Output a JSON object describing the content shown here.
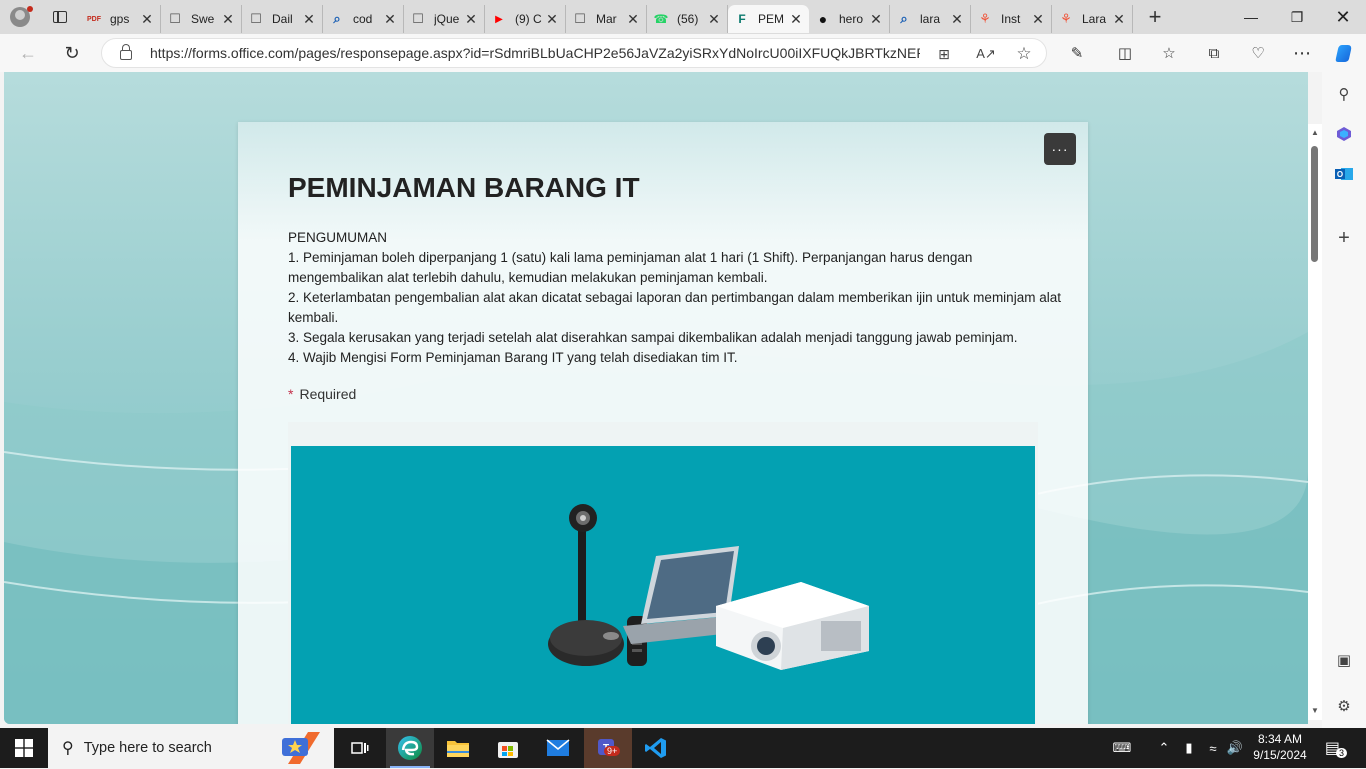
{
  "browser": {
    "tabs": [
      {
        "label": "gps",
        "icon": "pdf-icon"
      },
      {
        "label": "Swe",
        "icon": "page-icon"
      },
      {
        "label": "Dail",
        "icon": "page-icon"
      },
      {
        "label": "cod",
        "icon": "search-icon"
      },
      {
        "label": "jQue",
        "icon": "page-icon"
      },
      {
        "label": "(9) C",
        "icon": "youtube-icon"
      },
      {
        "label": "Mar",
        "icon": "page-icon"
      },
      {
        "label": "(56)",
        "icon": "whatsapp-icon"
      },
      {
        "label": "PEM",
        "icon": "forms-icon",
        "active": true
      },
      {
        "label": "hero",
        "icon": "github-icon"
      },
      {
        "label": "lara",
        "icon": "search-icon"
      },
      {
        "label": "Inst",
        "icon": "laravel-icon"
      },
      {
        "label": "Lara",
        "icon": "laravel-icon"
      }
    ],
    "url": "https://forms.office.com/pages/responsepage.aspx?id=rSdmriBLbUaCHP2e56JaVZa2yiSRxYdNoIrcU00iIXFUQkJBRTkzNERN..."
  },
  "form": {
    "title": "PEMINJAMAN BARANG IT",
    "description_lines": [
      "PENGUMUMAN",
      "1. Peminjaman boleh diperpanjang 1 (satu) kali lama peminjaman alat 1 hari (1 Shift). Perpanjangan harus dengan mengembalikan alat terlebih dahulu, kemudian melakukan peminjaman kembali.",
      "2. Keterlambatan pengembalian alat akan dicatat sebagai laporan dan pertimbangan dalam memberikan ijin untuk meminjam alat kembali.",
      "3. Segala kerusakan yang terjadi setelah alat diserahkan sampai dikembalikan adalah menjadi tanggung jawab peminjam.",
      "4. Wajib Mengisi Form Peminjaman Barang IT yang telah disediakan tim IT."
    ],
    "required_star": "*",
    "required_label": "Required",
    "more_label": "···"
  },
  "taskbar": {
    "search_placeholder": "Type here to search",
    "time": "8:34 AM",
    "date": "9/15/2024",
    "teams_badge": "9+",
    "notification_count": "3"
  },
  "colors": {
    "image_bg": "#03a1b2",
    "page_bg": "#9bcfd0",
    "active_tab": "#f7f7f7"
  }
}
